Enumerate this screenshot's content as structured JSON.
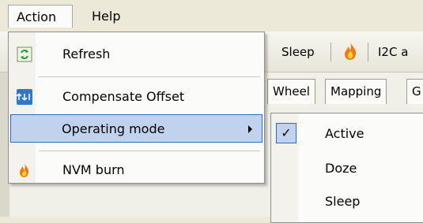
{
  "menubar": {
    "action": "Action",
    "help": "Help"
  },
  "toolbar": {
    "sleep": "Sleep",
    "i2c": "I2C a"
  },
  "tabs": [
    "Wheel",
    "Mapping",
    "G"
  ],
  "action_menu": {
    "items": [
      {
        "label": "Refresh",
        "icon": "refresh-icon"
      },
      {
        "label": "Compensate Offset",
        "icon": "compensate-icon"
      },
      {
        "label": "Operating mode",
        "icon": "",
        "has_submenu": true
      },
      {
        "label": "NVM burn",
        "icon": "fire-icon"
      }
    ]
  },
  "operating_mode_menu": {
    "items": [
      {
        "label": "Active",
        "checked": true
      },
      {
        "label": "Doze",
        "checked": false
      },
      {
        "label": "Sleep",
        "checked": false
      }
    ]
  },
  "colors": {
    "highlight": "#c1d2ee",
    "highlight_border": "#316ac5"
  }
}
